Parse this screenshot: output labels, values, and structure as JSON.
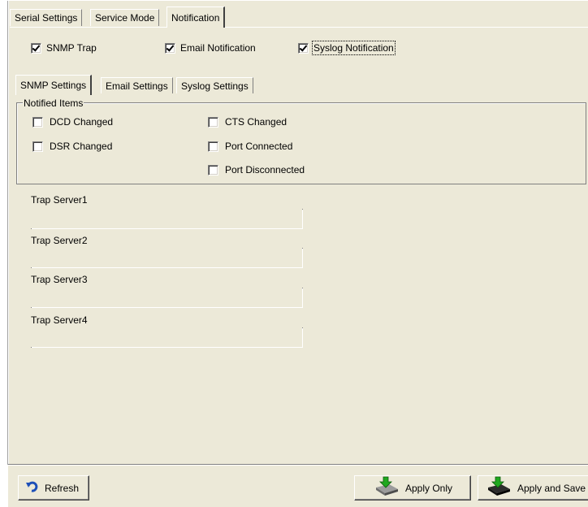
{
  "tabs": [
    "Serial Settings",
    "Service Mode",
    "Notification"
  ],
  "notifications": {
    "snmp_trap": {
      "label": "SNMP Trap",
      "checked": true
    },
    "email": {
      "label": "Email Notification",
      "checked": true
    },
    "syslog": {
      "label": "Syslog Notification",
      "checked": true
    }
  },
  "subtabs": [
    "SNMP Settings",
    "Email Settings",
    "Syslog Settings"
  ],
  "notified_items": {
    "title": "Notified Items",
    "items": [
      {
        "label": "DCD Changed",
        "checked": false
      },
      {
        "label": "CTS Changed",
        "checked": false
      },
      {
        "label": "DSR Changed",
        "checked": false
      },
      {
        "label": "Port Connected",
        "checked": false
      },
      {
        "label": "Port Disconnected",
        "checked": false
      }
    ]
  },
  "trap_servers": [
    {
      "label": "Trap Server1",
      "value": ""
    },
    {
      "label": "Trap Server2",
      "value": ""
    },
    {
      "label": "Trap Server3",
      "value": ""
    },
    {
      "label": "Trap Server4",
      "value": ""
    }
  ],
  "buttons": {
    "refresh": "Refresh",
    "apply_only": "Apply Only",
    "apply_and_save": "Apply and Save"
  },
  "icons": {
    "refresh": "refresh-arrow-icon",
    "apply_only": "disk-drive-green-arrow-icon",
    "apply_and_save": "disk-drive-black-arrow-icon"
  },
  "colors": {
    "panel": "#ece9d8",
    "shadow": "#808080",
    "highlight": "#ffffff"
  }
}
